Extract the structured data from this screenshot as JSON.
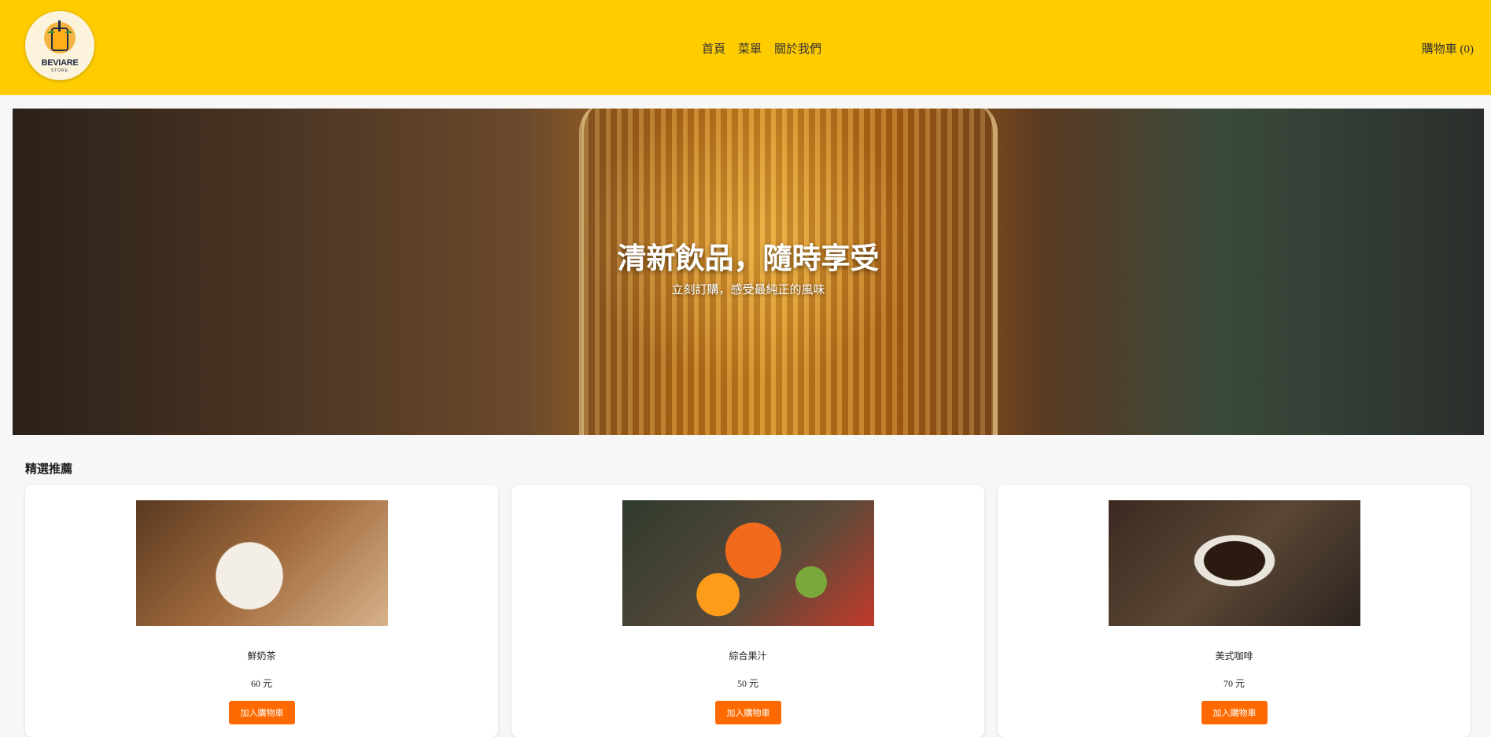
{
  "header": {
    "logo_text": "BEVIARE",
    "logo_sub": "STORE",
    "nav": [
      "首頁",
      "菜單",
      "關於我們"
    ],
    "cart_label": "購物車 (0)",
    "bg_color": "#ffcc00"
  },
  "hero": {
    "title": "清新飲品，隨時享受",
    "subtitle": "立刻訂購，感受最純正的風味"
  },
  "featured": {
    "title": "精選推薦",
    "products": [
      {
        "name": "鮮奶茶",
        "price": "60 元",
        "button": "加入購物車",
        "image": "milk-tea-image"
      },
      {
        "name": "綜合果汁",
        "price": "50 元",
        "button": "加入購物車",
        "image": "mixed-juice-image"
      },
      {
        "name": "美式咖啡",
        "price": "70 元",
        "button": "加入購物車",
        "image": "americano-image"
      }
    ],
    "button_color": "#ff6a00"
  }
}
